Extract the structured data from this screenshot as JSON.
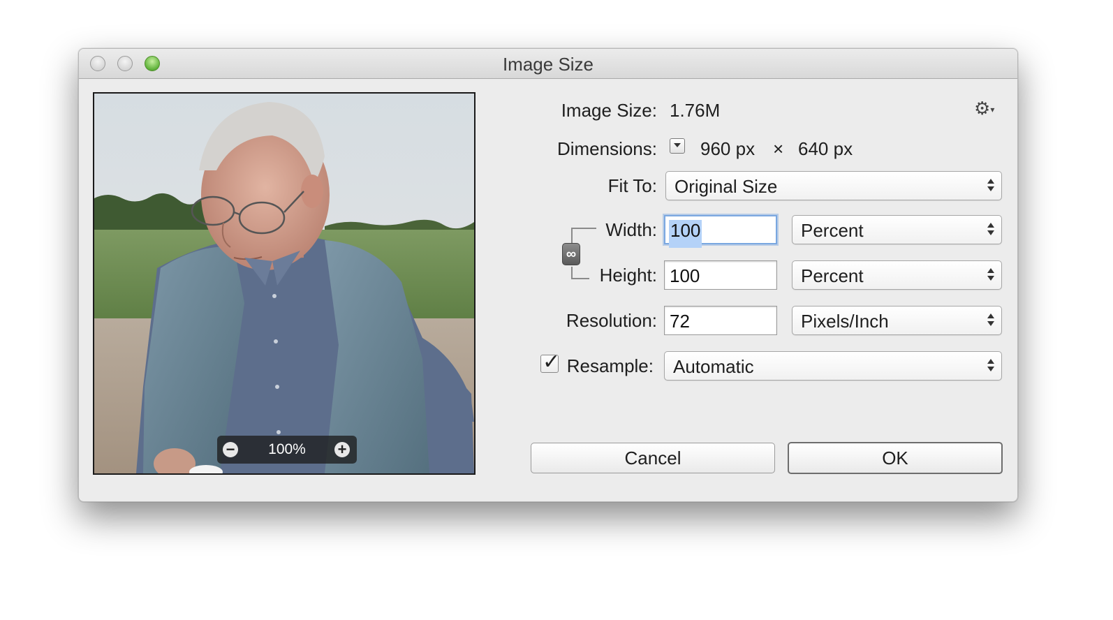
{
  "window": {
    "title": "Image Size"
  },
  "preview": {
    "zoom_level": "100%",
    "zoom_out_label": "−",
    "zoom_in_label": "+"
  },
  "info": {
    "image_size_label": "Image Size:",
    "image_size_value": "1.76M",
    "dimensions_label": "Dimensions:",
    "dimensions_width": "960 px",
    "dimensions_x": "×",
    "dimensions_height": "640 px"
  },
  "form": {
    "fit_to_label": "Fit To:",
    "fit_to_value": "Original Size",
    "width_label": "Width:",
    "width_value": "100",
    "width_unit": "Percent",
    "height_label": "Height:",
    "height_value": "100",
    "height_unit": "Percent",
    "resolution_label": "Resolution:",
    "resolution_value": "72",
    "resolution_unit": "Pixels/Inch",
    "resample_label": "Resample:",
    "resample_checked": true,
    "resample_value": "Automatic"
  },
  "buttons": {
    "cancel_label": "Cancel",
    "ok_label": "OK"
  },
  "icons": {
    "settings": "gear-icon",
    "constrain": "link-icon",
    "traffic_lights": [
      "close",
      "minimize",
      "zoom"
    ]
  },
  "colors": {
    "focus_ring": "#7aa7e0",
    "selection": "#b4d2f8",
    "zoom_button": "#5fb23a"
  }
}
